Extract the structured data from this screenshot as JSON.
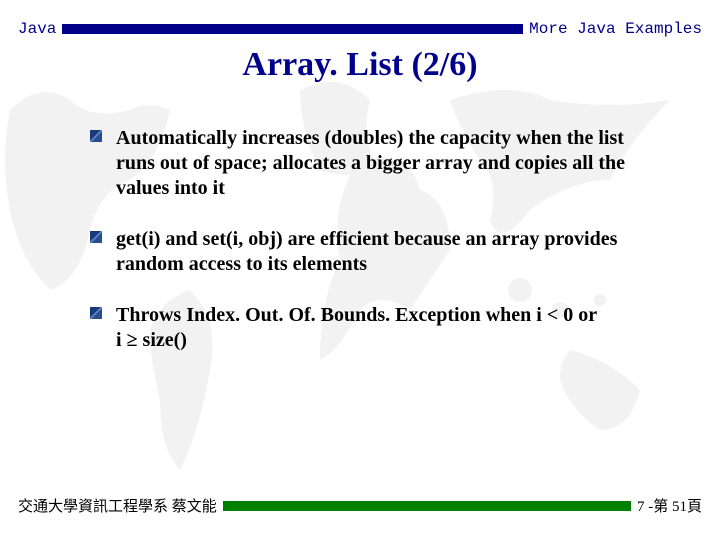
{
  "header": {
    "left": "Java",
    "right": "More Java Examples"
  },
  "title": "Array. List (2/6)",
  "bullets": [
    {
      "html": "Automatically increases (doubles) the capacity when the list runs out of space; allocates a bigger array and copies all the values into it"
    },
    {
      "html": "get(i) and set(i, obj) are efficient because an array provides random access to its elements"
    },
    {
      "html": "Throws Index. Out. Of. Bounds. Exception when i&nbsp;&lt;&nbsp;0 or i&nbsp;<span class=\"ge\">&#8805;</span>&nbsp;size()"
    }
  ],
  "footer": {
    "left": "交通大學資訊工程學系 蔡文能",
    "right": "7 -第 51頁"
  }
}
